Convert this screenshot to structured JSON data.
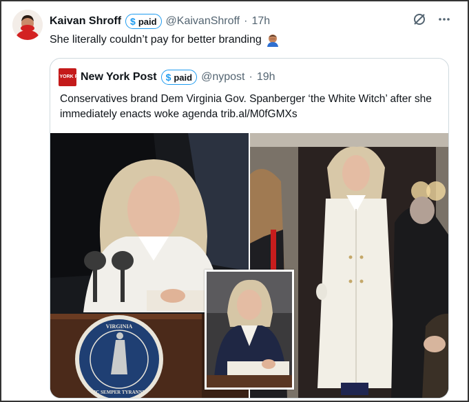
{
  "tweet": {
    "author_name": "Kaivan Shroff",
    "paid_label": "paid",
    "handle": "@KaivanShroff",
    "separator": "·",
    "time": "17h",
    "text": "She literally couldn’t pay for better branding",
    "emoji": "🤦🏽‍♂️"
  },
  "quote": {
    "logo_text": "NEW YORK POST",
    "author_name": "New York Post",
    "paid_label": "paid",
    "handle": "@nypost",
    "separator": "·",
    "time": "19h",
    "text": "Conservatives brand Dem Virginia Gov. Spanberger ‘the White Witch’ after she immediately enacts woke agenda trib.al/M0fGMXs"
  },
  "seal": {
    "top_text": "VIRGINIA",
    "bottom_text": "SIC SEMPER TYRANNIS"
  },
  "icons": {
    "badge": "dollar-icon",
    "grok": "grok-icon",
    "more": "more-icon"
  },
  "colors": {
    "accent": "#1d9bf0",
    "nyp_red": "#c41a1a",
    "seal_blue": "#1f3f73"
  }
}
